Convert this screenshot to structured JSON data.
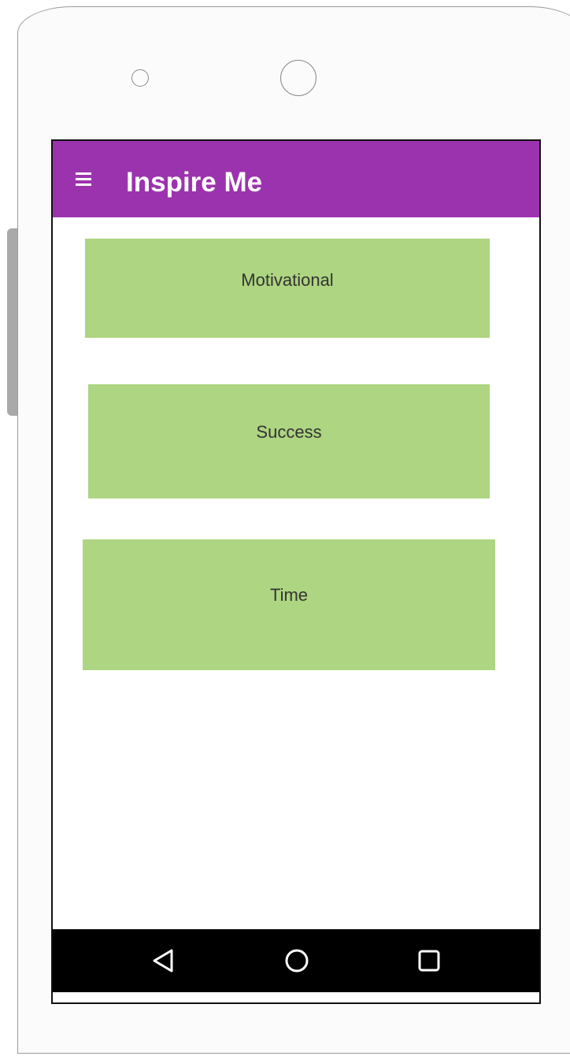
{
  "app_bar": {
    "title": "Inspire Me",
    "menu_icon": "hamburger-menu-icon",
    "color": "#9c33ae"
  },
  "categories": [
    {
      "label": "Motivational"
    },
    {
      "label": "Success"
    },
    {
      "label": "Time"
    }
  ],
  "card_color": "#aed581",
  "nav_bar": {
    "back_icon": "back-triangle-icon",
    "home_icon": "home-circle-icon",
    "recent_icon": "recent-apps-square-icon"
  }
}
